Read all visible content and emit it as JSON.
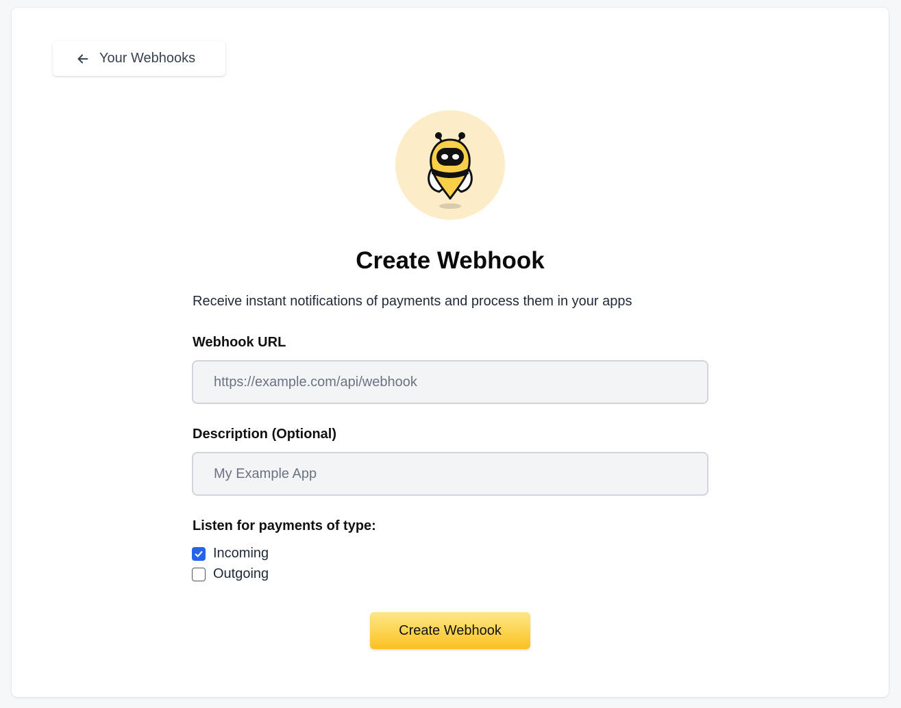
{
  "nav": {
    "back_label": "Your Webhooks",
    "back_icon": "arrow-left-icon"
  },
  "logo": {
    "icon": "bee-mascot-icon",
    "bg_color": "#fdecc8"
  },
  "header": {
    "title": "Create Webhook",
    "subtitle": "Receive instant notifications of payments and process them in your apps"
  },
  "form": {
    "url": {
      "label": "Webhook URL",
      "placeholder": "https://example.com/api/webhook",
      "value": ""
    },
    "description": {
      "label": "Description (Optional)",
      "placeholder": "My Example App",
      "value": ""
    },
    "payment_types": {
      "label": "Listen for payments of type:",
      "options": [
        {
          "label": "Incoming",
          "checked": true
        },
        {
          "label": "Outgoing",
          "checked": false
        }
      ]
    },
    "submit_label": "Create Webhook"
  },
  "colors": {
    "accent_button": "#fcd34d",
    "checkbox_checked": "#2563eb"
  }
}
